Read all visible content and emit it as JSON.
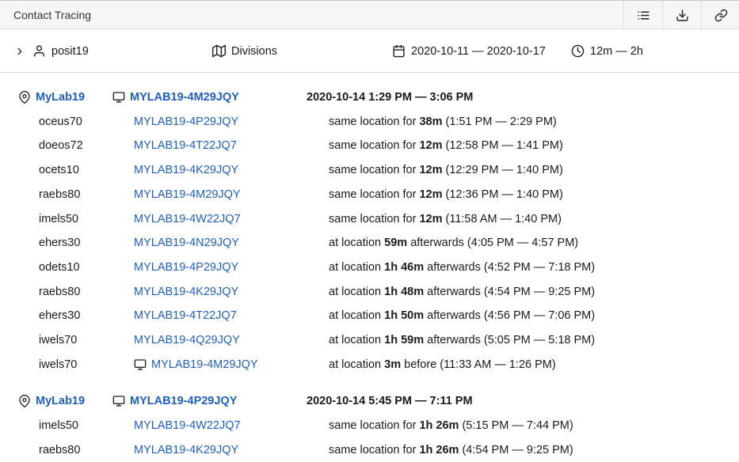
{
  "app": {
    "title": "Contact Tracing"
  },
  "toolbar": {
    "icons": [
      "list-icon",
      "download-icon",
      "link-icon"
    ]
  },
  "filters": {
    "user": "posit19",
    "divisions": "Divisions",
    "date_range": "2020-10-11 — 2020-10-17",
    "duration_range": "12m — 2h"
  },
  "colors": {
    "link": "#1f5fbf",
    "text": "#1a1a1a",
    "border": "#dcdcdc"
  },
  "groups": [
    {
      "location": "MyLab19",
      "device": "MYLAB19-4M29JQY",
      "time": "2020-10-14 1:29 PM — 3:06 PM",
      "contacts": [
        {
          "user": "oceus70",
          "device": "MYLAB19-4P29JQY",
          "pre": "same location for ",
          "dur": "38m",
          "post": " (1:51 PM — 2:29 PM)"
        },
        {
          "user": "doeos72",
          "device": "MYLAB19-4T22JQ7",
          "pre": "same location for ",
          "dur": "12m",
          "post": " (12:58 PM — 1:41 PM)"
        },
        {
          "user": "ocets10",
          "device": "MYLAB19-4K29JQY",
          "pre": "same location for ",
          "dur": "12m",
          "post": " (12:29 PM — 1:40 PM)"
        },
        {
          "user": "raebs80",
          "device": "MYLAB19-4M29JQY",
          "pre": "same location for ",
          "dur": "12m",
          "post": " (12:36 PM — 1:40 PM)"
        },
        {
          "user": "imels50",
          "device": "MYLAB19-4W22JQ7",
          "pre": "same location for ",
          "dur": "12m",
          "post": " (11:58 AM — 1:40 PM)"
        },
        {
          "user": "ehers30",
          "device": "MYLAB19-4N29JQY",
          "pre": "at location ",
          "dur": "59m",
          "post": " afterwards (4:05 PM — 4:57 PM)"
        },
        {
          "user": "odets10",
          "device": "MYLAB19-4P29JQY",
          "pre": "at location ",
          "dur": "1h 46m",
          "post": " afterwards (4:52 PM — 7:18 PM)"
        },
        {
          "user": "raebs80",
          "device": "MYLAB19-4K29JQY",
          "pre": "at location ",
          "dur": "1h 48m",
          "post": " afterwards (4:54 PM — 9:25 PM)"
        },
        {
          "user": "ehers30",
          "device": "MYLAB19-4T22JQ7",
          "pre": "at location ",
          "dur": "1h 50m",
          "post": " afterwards (4:56 PM — 7:06 PM)"
        },
        {
          "user": "iwels70",
          "device": "MYLAB19-4Q29JQY",
          "pre": "at location ",
          "dur": "1h 59m",
          "post": " afterwards (5:05 PM — 5:18 PM)"
        },
        {
          "user": "iwels70",
          "device": "MYLAB19-4M29JQY",
          "device_icon": true,
          "pre": "at location ",
          "dur": "3m",
          "post": " before (11:33 AM — 1:26 PM)"
        }
      ]
    },
    {
      "location": "MyLab19",
      "device": "MYLAB19-4P29JQY",
      "time": "2020-10-14 5:45 PM — 7:11 PM",
      "contacts": [
        {
          "user": "imels50",
          "device": "MYLAB19-4W22JQ7",
          "pre": "same location for ",
          "dur": "1h 26m",
          "post": " (5:15 PM — 7:44 PM)"
        },
        {
          "user": "raebs80",
          "device": "MYLAB19-4K29JQY",
          "pre": "same location for ",
          "dur": "1h 26m",
          "post": " (4:54 PM — 9:25 PM)"
        }
      ]
    }
  ]
}
